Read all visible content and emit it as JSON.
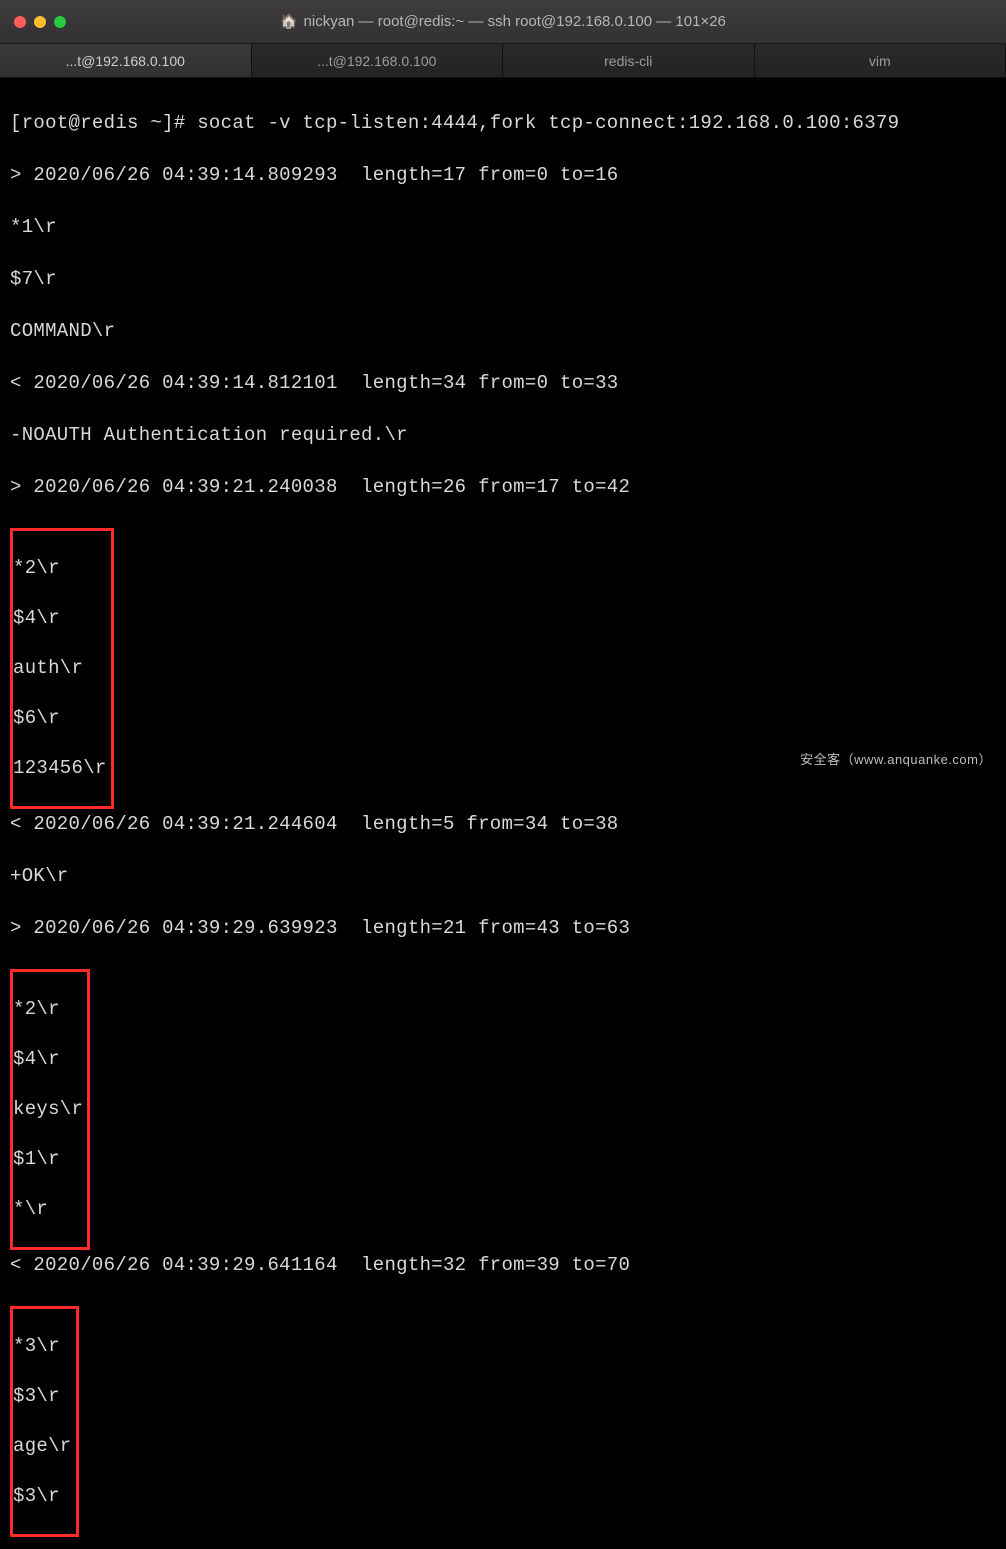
{
  "window": {
    "title": "nickyan — root@redis:~ — ssh root@192.168.0.100 — 101×26"
  },
  "tabs": [
    {
      "label": "...t@192.168.0.100",
      "active": true
    },
    {
      "label": "...t@192.168.0.100",
      "active": false
    },
    {
      "label": "redis-cli",
      "active": false
    },
    {
      "label": "vim",
      "active": false
    }
  ],
  "terminal": {
    "prompt": "[root@redis ~]# socat -v tcp-listen:4444,fork tcp-connect:192.168.0.100:6379",
    "lines1": [
      "> 2020/06/26 04:39:14.809293  length=17 from=0 to=16",
      "*1\\r",
      "$7\\r",
      "COMMAND\\r",
      "< 2020/06/26 04:39:14.812101  length=34 from=0 to=33",
      "-NOAUTH Authentication required.\\r",
      "> 2020/06/26 04:39:21.240038  length=26 from=17 to=42"
    ],
    "box1": [
      "*2\\r",
      "$4\\r",
      "auth\\r",
      "$6\\r",
      "123456\\r"
    ],
    "lines2": [
      "< 2020/06/26 04:39:21.244604  length=5 from=34 to=38",
      "+OK\\r",
      "> 2020/06/26 04:39:29.639923  length=21 from=43 to=63"
    ],
    "box2": [
      "*2\\r",
      "$4\\r",
      "keys\\r",
      "$1\\r",
      "*\\r"
    ],
    "lines3": [
      "< 2020/06/26 04:39:29.641164  length=32 from=39 to=70"
    ],
    "box3": [
      "*3\\r",
      "$3\\r",
      "age\\r",
      "$3\\r"
    ]
  },
  "watermark": "安全客（www.anquanke.com）"
}
